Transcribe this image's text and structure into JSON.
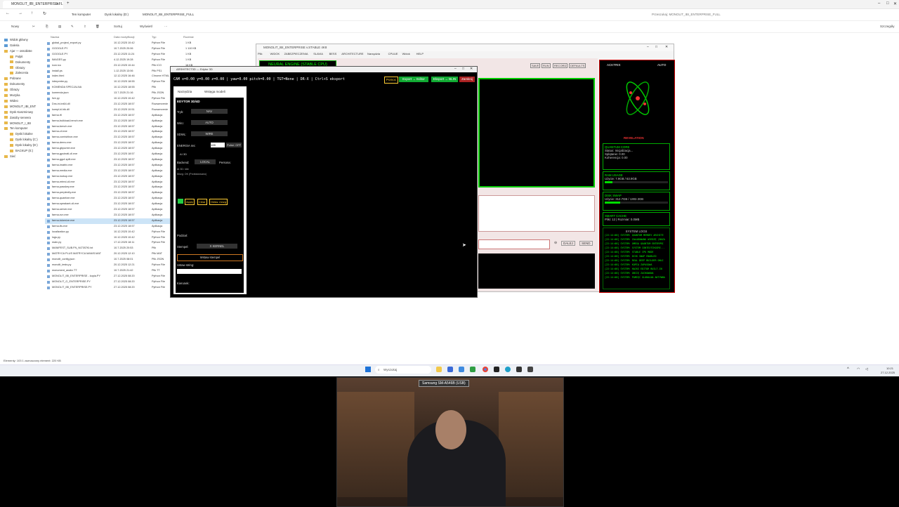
{
  "explorer": {
    "tab_title": "MONOLIT_IBI_ENTERPRISE.FL",
    "breadcrumb": [
      "Ten komputer",
      "Dysk lokalny (D:)",
      "MONOLIT_IBI_ENTERPRISE_FULL"
    ],
    "search_placeholder": "Przeszukaj: MONOLIT_IBI_ENTERPRISE_FULL",
    "toolbar": {
      "new_label": "Nowy",
      "sort_label": "Sortuj",
      "view_label": "Wyświetl",
      "details_label": "Szczegóły"
    },
    "nav_items": [
      "Widok główny",
      "Galeria",
      "Ajar — ossobiste",
      "Pulpit",
      "Dokumenty",
      "Obrazy",
      "Zalecenia",
      "Pobrane",
      "Dokumenty",
      "Obrazy",
      "Muzyka",
      "Wideo",
      "MONOLIT_IBI_ENT",
      "Dysk Kaszmirowy",
      "Zasoby serwera",
      "MONOLIT_I_IBI",
      "Ten komputer",
      "Dyski lokalne",
      "Dysk lokalny (C:)",
      "Dysk lokalny (D:)",
      "BACKUP (E:)",
      "Sieć"
    ],
    "columns": {
      "name": "Nazwa",
      "date": "Data modyfikacji",
      "type": "Typ",
      "size": "Rozmiar"
    },
    "files": [
      {
        "name": "global_project_export.py",
        "date": "10.12.2025 10:42",
        "type": "Python File",
        "size": "1 KB"
      },
      {
        "name": "GOOGLE.PY",
        "date": "10.7.2025 20:06",
        "type": "Python File",
        "size": "1 110 KB"
      },
      {
        "name": "GOOGLE.PY",
        "date": "23.12.2025 11:24",
        "type": "Python File",
        "size": "1 KB"
      },
      {
        "name": "IMAGES.py",
        "date": "4.12.2025 19:28",
        "type": "Python File",
        "size": "1 KB"
      },
      {
        "name": "icon.ico",
        "date": "23.12.2025 10:44",
        "type": "Plik ICO",
        "size": "16 KB"
      },
      {
        "name": "install.ps",
        "date": "1.12.2025 13:06",
        "type": "Plik PS1",
        "size": "1 KB"
      },
      {
        "name": "index.html",
        "date": "12.12.2025 16:46",
        "type": "Chrome HTML",
        "size": "2 KB"
      },
      {
        "name": "interpreter.py",
        "date": "10.12.2025 18:55",
        "type": "Python File",
        "size": "2 KB"
      },
      {
        "name": "KOMENDA SPECJALNA",
        "date": "10.12.2025 18:55",
        "type": "Plik",
        "size": "1 KB"
      },
      {
        "name": "komenda.json",
        "date": "13.7.2025 21:16",
        "type": "Plik JSON",
        "size": "1 KB"
      },
      {
        "name": "live.py",
        "date": "10.12.2025 10:42",
        "type": "Python File",
        "size": "1 KB"
      },
      {
        "name": "Dns.ini.ini64.dll",
        "date": "23.12.2025 18:57",
        "type": "Rozszerzenie",
        "size": "2 KB"
      },
      {
        "name": "kompl-kl.bik.dll",
        "date": "23.12.2025 10:51",
        "type": "Rozszerzenie",
        "size": "1 KB"
      },
      {
        "name": "farma.rfi",
        "date": "23.12.2025 18:57",
        "type": "Aplikacja",
        "size": "1 KB"
      },
      {
        "name": "farma-bulkload-bench.exe",
        "date": "23.12.2025 18:57",
        "type": "Aplikacja",
        "size": "2 KB"
      },
      {
        "name": "farma-bench.exe",
        "date": "23.12.2025 18:57",
        "type": "Aplikacja",
        "size": "1 KB"
      },
      {
        "name": "farma-cli.exe",
        "date": "23.12.2025 18:57",
        "type": "Aplikacja",
        "size": "1 KB"
      },
      {
        "name": "farma-cornishbon.exe",
        "date": "23.12.2025 18:57",
        "type": "Aplikacja",
        "size": "1 KB"
      },
      {
        "name": "farma-demo.exe",
        "date": "23.12.2025 18:57",
        "type": "Aplikacja",
        "size": "1 KB"
      },
      {
        "name": "farma-gbpunter.exe",
        "date": "23.12.2025 18:57",
        "type": "Aplikacja",
        "size": "1 KB"
      },
      {
        "name": "farma-gpuinati-cli.exe",
        "date": "23.12.2025 18:57",
        "type": "Aplikacja",
        "size": "1 KB"
      },
      {
        "name": "farma-gguf-split.exe",
        "date": "23.12.2025 18:57",
        "type": "Aplikacja",
        "size": "1 KB"
      },
      {
        "name": "farma-imatrix.exe",
        "date": "23.12.2025 18:57",
        "type": "Aplikacja",
        "size": "1 KB"
      },
      {
        "name": "farma-media.exe",
        "date": "23.12.2025 18:57",
        "type": "Aplikacja",
        "size": "1 KB"
      },
      {
        "name": "farma-lookup.exe",
        "date": "23.12.2025 18:57",
        "type": "Aplikacja",
        "size": "1 KB"
      },
      {
        "name": "farma-mtmd-cli.exe",
        "date": "23.12.2025 18:57",
        "type": "Aplikacja",
        "size": "1 KB"
      },
      {
        "name": "farma-passkey.exe",
        "date": "23.12.2025 18:57",
        "type": "Aplikacja",
        "size": "1 KB"
      },
      {
        "name": "farma-perplexity.exe",
        "date": "23.12.2025 18:57",
        "type": "Aplikacja",
        "size": "1 KB"
      },
      {
        "name": "farma-quantize.exe",
        "date": "23.12.2025 18:57",
        "type": "Aplikacja",
        "size": "1 KB"
      },
      {
        "name": "farma-speakant-cli.exe",
        "date": "23.12.2025 18:57",
        "type": "Aplikacja",
        "size": "1 KB"
      },
      {
        "name": "farma-server.exe",
        "date": "23.12.2025 18:57",
        "type": "Aplikacja",
        "size": "1 KB"
      },
      {
        "name": "farma-run.exe",
        "date": "23.12.2025 18:57",
        "type": "Aplikacja",
        "size": "1 KB"
      },
      {
        "name": "farma-tokenize.exe",
        "date": "23.12.2025 18:57",
        "type": "Aplikacja",
        "size": "1 KB"
      },
      {
        "name": "farma-tts.exe",
        "date": "23.12.2025 18:57",
        "type": "Aplikacja",
        "size": "1 KB"
      },
      {
        "name": "localization.py",
        "date": "10.12.2025 10:42",
        "type": "Python File",
        "size": "1 KB"
      },
      {
        "name": "logs.py",
        "date": "10.12.2025 10:42",
        "type": "Python File",
        "size": "1 KB"
      },
      {
        "name": "main.py",
        "date": "17.12.2025 18:11",
        "type": "Python File",
        "size": "1 KB"
      },
      {
        "name": "MANIFEST_SUB.FN_NOTATKI.txt",
        "date": "10.7.2025 20:53",
        "type": "Plik",
        "size": "1 KB"
      },
      {
        "name": "MATRYCA PLUS MATRYCA MANIS.MAT",
        "date": "20.12.2025 12:10",
        "type": "Plik MAT",
        "size": "1 KB"
      },
      {
        "name": "monolit_config.json",
        "date": "10.7.2025 08:01",
        "type": "Plik JSON",
        "size": "1 KB"
      },
      {
        "name": "monolit_tests.py",
        "date": "20.12.2025 12:21",
        "type": "Python File",
        "size": "1 KB"
      },
      {
        "name": "monument_analiz.TT",
        "date": "10.7.2025 21:42",
        "type": "Plik TT",
        "size": "1 KB"
      },
      {
        "name": "MONOLIT_IBI_ENTERPRISE - kopia.PY",
        "date": "27.12.2025 08:20",
        "type": "Python File",
        "size": "56 KB"
      },
      {
        "name": "MONOLIT_G_ENTERPRISE.PY",
        "date": "27.12.2025 08:20",
        "type": "Python File",
        "size": "51 KB"
      },
      {
        "name": "MONOLIT_IBI_ENTERPRISE.PY",
        "date": "27.12.2025 08:20",
        "type": "Python File",
        "size": "51 KB"
      }
    ],
    "selected_file": "farma-tokenize.exe",
    "status": "Elementy: 103    1 zaznaczony element: 220 KB"
  },
  "taskbar": {
    "search_label": "Wyszukaj",
    "time": "10:21",
    "date": "27.12.2025"
  },
  "monolit": {
    "title": "MONOLIT_IBI_ENTERPRISE v.STABLE 4K8",
    "menu": [
      "Plik",
      "WIDOK",
      "ZABEZPIECZENIA",
      "SLAVIA",
      "BESS",
      "ARCHITECTURE",
      "Narzędzia",
      "CPUUE",
      "Widok",
      "HELP"
    ],
    "banner": "NEURAL ENGINE (STABLE CPU)",
    "top_buttons": [
      "SAVE",
      "RUN",
      "RECORD",
      "DEFAULTS"
    ],
    "input_buttons": [
      "DALEJ",
      "SEND"
    ],
    "right": {
      "acktrix": "ACKTRIX",
      "auto": "AUTO",
      "revelation": "REVELATION",
      "quantum_title": "QUANTUM CORE",
      "quantum_status": "Status: Inicjalizacja...",
      "quantum_spl": "Splątanie: 0.00",
      "quantum_koh": "Koherencja: 0.00",
      "ram_title": "RAM USAGE",
      "ram_value": "Użycie: 7.9GB / 63.9GB",
      "ram_pct": 0.12,
      "disk_title": "DISK SWAP",
      "disk_value": "Użycie: 312.7GB / 1302.3GB",
      "disk_pct": 0.24,
      "cache_title": "SMART CACHE",
      "cache_value": "Pliki: 12 | Rozmiar: 0.0MB",
      "logs_title": "SYSTEM LOGS",
      "logs": [
        "[22:14:08] SYSTEM: QUANTUM MEMORY ARCHITE",
        "[22:14:08] SYSTEM: ZAŁADOWANO WIEDZĘ (BAZA",
        "[22:14:08] SYSTEM: OMEGA QUANTUM ENTERPRI",
        "[22:14:08] SYSTEM: SYSTEM CONTEXTCHOIRE...",
        "[22:14:08] SYSTEM: STABLE CPU MODE",
        "[22:14:08] SYSTEM: DISK SWAP ENABLED",
        "[22:14:08] SYSTEM: REAL DEEP BUILDER ONLI",
        "[22:14:08] SYSTEM: KOPIA ZAPASOWA",
        "[22:14:08] SYSTEM: HACKS EDITOR BUILT-IN",
        "[22:14:08] SYSTEM: OBCIĘ ZACHOWANA",
        "[22:14:08] SYSTEM: PAMIĘĆ GLOBALNA AKTYWNA"
      ]
    }
  },
  "editor": {
    "title": "ARSHITECT3D — Edytor 3D",
    "status_line": "CAM x=0.00 y=0.00 z=0.00 | yaw=0.00 pitch=0.00 | TGT=None | DR-X | Ctrl+S eksport",
    "buttons": [
      "Pomoc",
      "Export → Editor",
      "Eksport → BLIN",
      "Zamknij"
    ],
    "tabs": [
      "Narzędzia",
      "Wstęga modeli"
    ],
    "side": {
      "header": "EDYTOR 3D/4D",
      "tryb_label": "Tryb:",
      "tryb_value": "NAV",
      "wiro_label": "Wiro:",
      "wiro_value": "AUTO",
      "sdwl_label": "SDWL:",
      "sdwl_value": "WIRE",
      "energia_label": "ENERGIA ms:",
      "energia_value": "128",
      "pulse_label": "Pulse: OFF",
      "ai_header": "AI 3D",
      "backend_label": "Backend:",
      "backend_value": "LOCAL",
      "persona_label": "Persona:",
      "ai_log_1": "AI 3D: Idle",
      "ai_log_2": "Mózg: OK (Przeładowano)",
      "ai_buttons": [
        "Apply",
        "Clear",
        "Odśw. mózg"
      ],
      "podzial_label": "Podział:",
      "stempel_label": "Stempel:",
      "stempel_value": "X KERNEL",
      "wstaw_stempel": "Wstaw stempel",
      "ustaw_string": "Ustaw string:",
      "kierunek_label": "Kierunek:"
    }
  },
  "webcam": {
    "label": "Samsung SM-A546B (USB)"
  }
}
